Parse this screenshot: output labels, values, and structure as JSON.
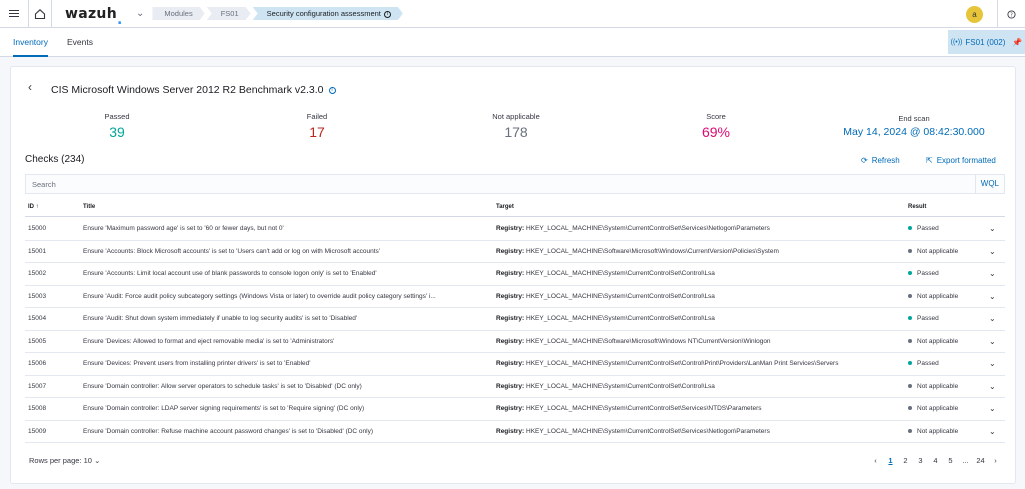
{
  "header": {
    "logo_text": "wazuh",
    "logo_dot": ".",
    "breadcrumbs": [
      "Modules",
      "FS01",
      "Security configuration assessment"
    ],
    "avatar_initial": "a"
  },
  "tabs": {
    "inventory": "Inventory",
    "events": "Events",
    "agent_label": "FS01 (002)"
  },
  "policy": {
    "title": "CIS Microsoft Windows Server 2012 R2 Benchmark v2.3.0"
  },
  "stats": {
    "passed_label": "Passed",
    "passed": "39",
    "failed_label": "Failed",
    "failed": "17",
    "na_label": "Not applicable",
    "na": "178",
    "score_label": "Score",
    "score": "69%",
    "end_label": "End scan",
    "end_scan": "May 14, 2024 @ 08:42:30.000"
  },
  "checks": {
    "title": "Checks (234)",
    "refresh": "Refresh",
    "export": "Export formatted",
    "search_placeholder": "Search",
    "wql": "WQL"
  },
  "table": {
    "headers": {
      "id": "ID ↑",
      "title": "Title",
      "target": "Target",
      "result": "Result"
    },
    "rows": [
      {
        "id": "15000",
        "title": "Ensure 'Maximum password age' is set to '60 or fewer days, but not 0'",
        "target_label": "Registry:",
        "target": " HKEY_LOCAL_MACHINE\\System\\CurrentControlSet\\Services\\Netlogon\\Parameters",
        "result": "Passed"
      },
      {
        "id": "15001",
        "title": "Ensure 'Accounts: Block Microsoft accounts' is set to 'Users can't add or log on with Microsoft accounts'",
        "target_label": "Registry:",
        "target": " HKEY_LOCAL_MACHINE\\Software\\Microsoft\\Windows\\CurrentVersion\\Policies\\System",
        "result": "Not applicable"
      },
      {
        "id": "15002",
        "title": "Ensure 'Accounts: Limit local account use of blank passwords to console logon only' is set to 'Enabled'",
        "target_label": "Registry:",
        "target": " HKEY_LOCAL_MACHINE\\System\\CurrentControlSet\\Control\\Lsa",
        "result": "Passed"
      },
      {
        "id": "15003",
        "title": "Ensure 'Audit: Force audit policy subcategory settings (Windows Vista or later) to override audit policy category settings' i...",
        "target_label": "Registry:",
        "target": " HKEY_LOCAL_MACHINE\\System\\CurrentControlSet\\Control\\Lsa",
        "result": "Not applicable"
      },
      {
        "id": "15004",
        "title": "Ensure 'Audit: Shut down system immediately if unable to log security audits' is set to 'Disabled'",
        "target_label": "Registry:",
        "target": " HKEY_LOCAL_MACHINE\\System\\CurrentControlSet\\Control\\Lsa",
        "result": "Passed"
      },
      {
        "id": "15005",
        "title": "Ensure 'Devices: Allowed to format and eject removable media' is set to 'Administrators'",
        "target_label": "Registry:",
        "target": " HKEY_LOCAL_MACHINE\\Software\\Microsoft\\Windows NT\\CurrentVersion\\Winlogon",
        "result": "Not applicable"
      },
      {
        "id": "15006",
        "title": "Ensure 'Devices: Prevent users from installing printer drivers' is set to 'Enabled'",
        "target_label": "Registry:",
        "target": " HKEY_LOCAL_MACHINE\\System\\CurrentControlSet\\Control\\Print\\Providers\\LanMan Print Services\\Servers",
        "result": "Passed"
      },
      {
        "id": "15007",
        "title": "Ensure 'Domain controller: Allow server operators to schedule tasks' is set to 'Disabled' (DC only)",
        "target_label": "Registry:",
        "target": " HKEY_LOCAL_MACHINE\\System\\CurrentControlSet\\Control\\Lsa",
        "result": "Not applicable"
      },
      {
        "id": "15008",
        "title": "Ensure 'Domain controller: LDAP server signing requirements' is set to 'Require signing' (DC only)",
        "target_label": "Registry:",
        "target": " HKEY_LOCAL_MACHINE\\System\\CurrentControlSet\\Services\\NTDS\\Parameters",
        "result": "Not applicable"
      },
      {
        "id": "15009",
        "title": "Ensure 'Domain controller: Refuse machine account password changes' is set to 'Disabled' (DC only)",
        "target_label": "Registry:",
        "target": " HKEY_LOCAL_MACHINE\\System\\CurrentControlSet\\Services\\Netlogon\\Parameters",
        "result": "Not applicable"
      }
    ]
  },
  "footer": {
    "rows_per_page": "Rows per page: 10",
    "pages": [
      "1",
      "2",
      "3",
      "4",
      "5",
      "...",
      "24"
    ]
  },
  "colors": {
    "passed": "#00a69b",
    "failed": "#bd271e",
    "na": "#69707d",
    "score": "#dd0a73",
    "accent": "#006bb8"
  }
}
